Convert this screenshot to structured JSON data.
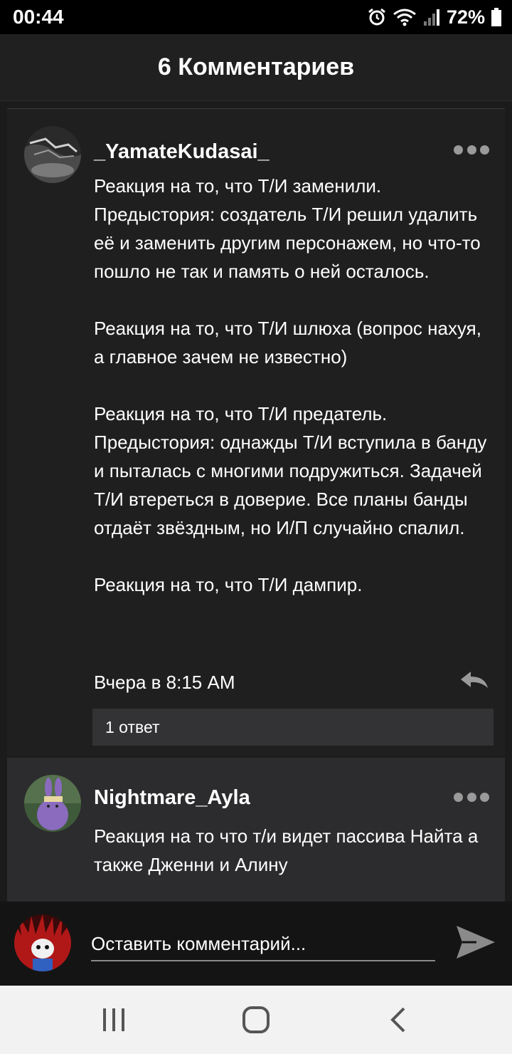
{
  "status_bar": {
    "time": "00:44",
    "battery_percent": "72%",
    "icons": [
      "alarm-icon",
      "wifi-icon",
      "signal-icon",
      "battery-icon"
    ]
  },
  "header": {
    "title": "6 Комментариев"
  },
  "comments": [
    {
      "username": "_YamateKudasai_",
      "text": "Реакция на то, что Т/И заменили.\nПредыстория: создатель Т/И решил удалить её и заменить другим персонажем, но что-то пошло не так и память о ней осталось.\n\nРеакция на то, что Т/И шлюха (вопрос нахуя, а главное зачем не известно)\n\nРеакция на то, что Т/И предатель. Предыстория: однажды Т/И вступила в банду и пыталась с многими подружиться. Задачей Т/И втереться в доверие. Все планы банды отдаёт звёздным, но И/П случайно спалил.\n\nРеакция на то, что Т/И дампир.",
      "timestamp": "Вчера в 8:15 AM",
      "replies_label": "1 ответ"
    },
    {
      "username": "Nightmare_Ayla",
      "text": "Реакция на то что т/и видет пассива Найта а также Дженни и Алину"
    }
  ],
  "compose": {
    "placeholder": "Оставить комментарий..."
  },
  "colors": {
    "background": "#1b1b1b",
    "header": "#202020",
    "highlighted_comment": "#2c2c2e",
    "replies_bar": "#333335",
    "nav_bar": "#f2f2f2"
  }
}
